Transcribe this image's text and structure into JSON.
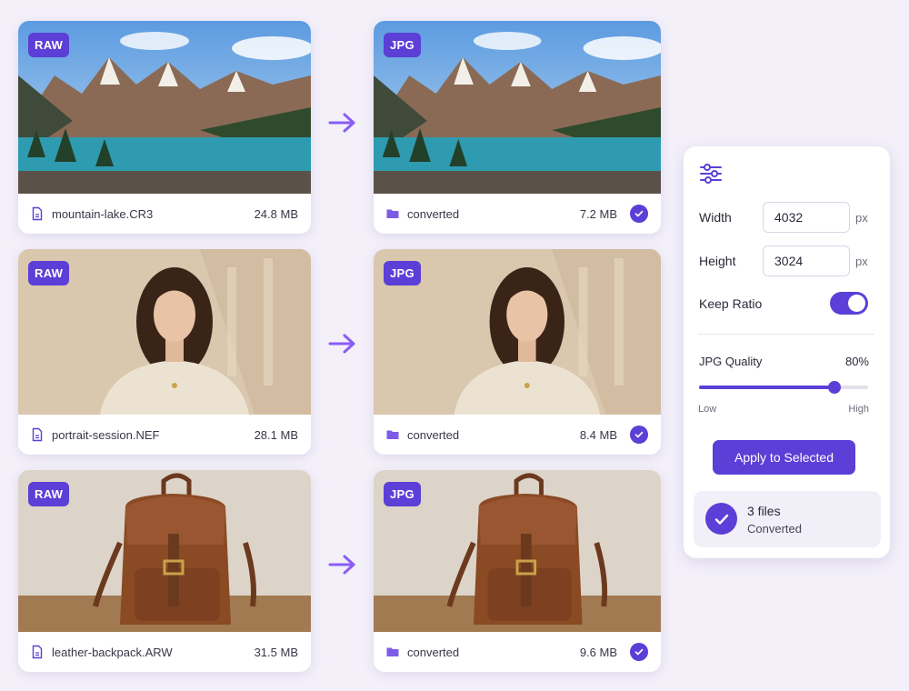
{
  "colors": {
    "accent": "#5b3fd6",
    "background": "#f3f0fa",
    "card": "#ffffff"
  },
  "rows": [
    {
      "source": {
        "badge": "RAW",
        "filename": "mountain-lake.CR3",
        "size": "24.8 MB",
        "image": "mountain-lake-photo",
        "icon": "file-icon"
      },
      "output": {
        "badge": "JPG",
        "label": "converted",
        "size": "7.2 MB",
        "image": "mountain-lake-photo",
        "icon": "folder-icon",
        "status_icon": "check-circle-icon"
      }
    },
    {
      "source": {
        "badge": "RAW",
        "filename": "portrait-session.NEF",
        "size": "28.1 MB",
        "image": "portrait-photo",
        "icon": "file-icon"
      },
      "output": {
        "badge": "JPG",
        "label": "converted",
        "size": "8.4 MB",
        "image": "portrait-photo",
        "icon": "folder-icon",
        "status_icon": "check-circle-icon"
      }
    },
    {
      "source": {
        "badge": "RAW",
        "filename": "leather-backpack.ARW",
        "size": "31.5 MB",
        "image": "backpack-photo",
        "icon": "file-icon"
      },
      "output": {
        "badge": "JPG",
        "label": "converted",
        "size": "9.6 MB",
        "image": "backpack-photo",
        "icon": "folder-icon",
        "status_icon": "check-circle-icon"
      }
    }
  ],
  "panel": {
    "settings_icon": "sliders-icon",
    "width": {
      "label": "Width",
      "value": "4032",
      "unit": "px"
    },
    "height": {
      "label": "Height",
      "value": "3024",
      "unit": "px"
    },
    "keep_ratio": {
      "label": "Keep Ratio",
      "enabled": true
    },
    "quality": {
      "label": "JPG Quality",
      "value_text": "80%",
      "value": 0.8,
      "low_label": "Low",
      "high_label": "High"
    },
    "apply_label": "Apply to Selected",
    "summary": {
      "line1": "3 files",
      "line2": "Converted",
      "icon": "check-circle-icon"
    }
  }
}
